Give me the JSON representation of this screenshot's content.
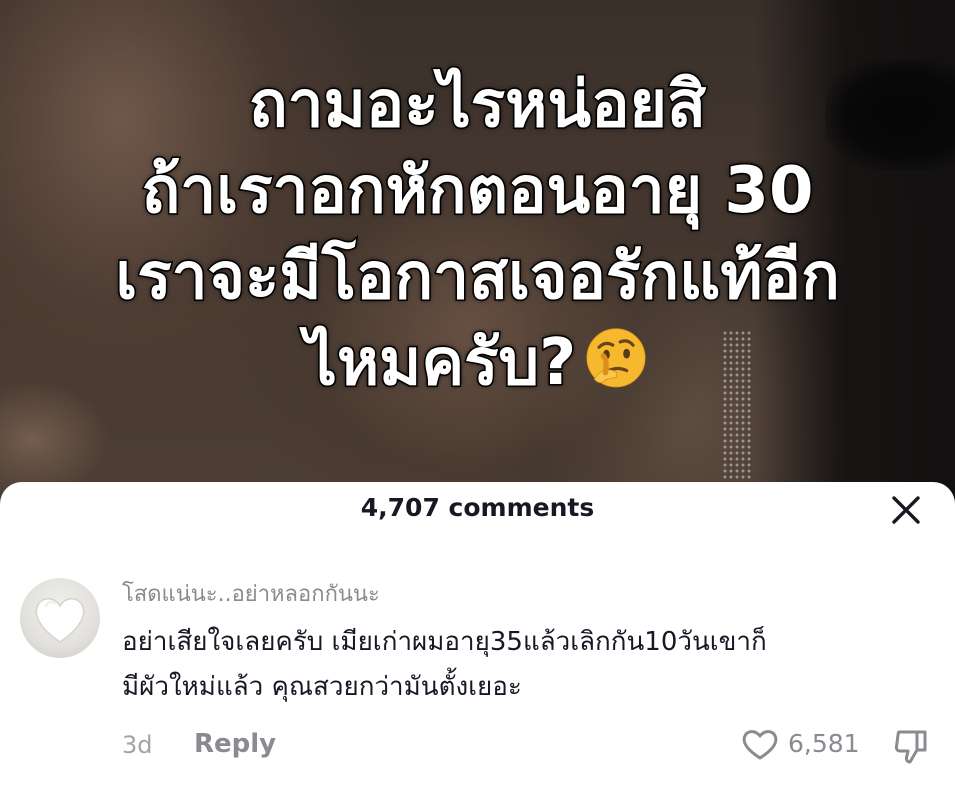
{
  "video": {
    "caption_lines": [
      "ถามอะไรหน่อยสิ",
      "ถ้าเราอกหักตอนอายุ 30",
      "เราจะมีโอกาสเจอรักแท้อีก",
      "ไหมครับ?"
    ],
    "caption_emoji": "thinking-face-emoji"
  },
  "comments_sheet": {
    "count_label": "4,707 comments",
    "close_icon": "close-icon"
  },
  "comment": {
    "avatar_icon": "white-heart-avatar",
    "username": "โสดแน่นะ..อย่าหลอกกันนะ",
    "text_lines": [
      "อย่าเสียใจเลยครับ เมียเก่าผมอายุ35แล้วเลิกกัน10วันเขาก็",
      "มีผัวใหม่แล้ว คุณสวยกว่ามันตั้งเยอะ"
    ],
    "timestamp": "3d",
    "reply_label": "Reply",
    "like_icon": "heart-outline-icon",
    "like_count": "6,581",
    "dislike_icon": "thumbs-down-icon"
  }
}
